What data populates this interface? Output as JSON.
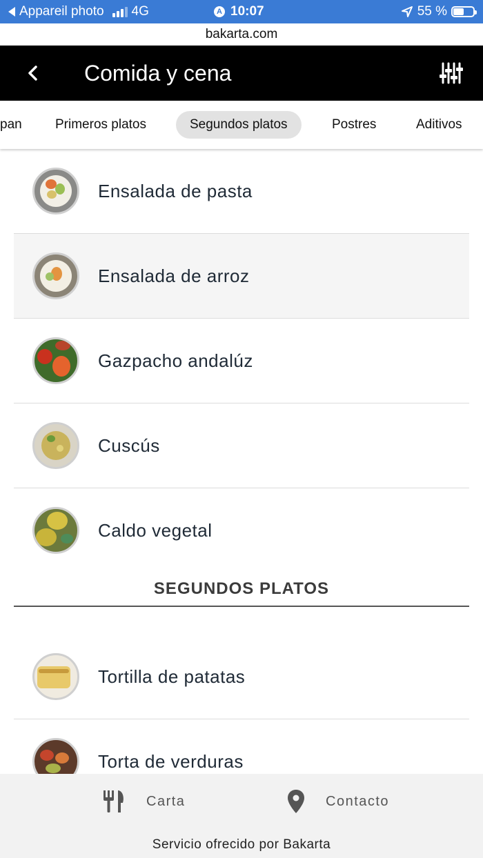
{
  "status_bar": {
    "back_app": "Appareil photo",
    "network": "4G",
    "time": "10:07",
    "battery": "55 %",
    "battery_level": 0.55
  },
  "url": "bakarta.com",
  "header": {
    "title": "Comida y cena",
    "back_icon": "chevron-left-icon",
    "filter_icon": "sliders-icon"
  },
  "tabs": [
    {
      "label": "pan"
    },
    {
      "label": "Primeros platos"
    },
    {
      "label": "Segundos platos",
      "active": true
    },
    {
      "label": "Postres"
    },
    {
      "label": "Aditivos"
    }
  ],
  "primeros": [
    {
      "name": "Ensalada de pasta"
    },
    {
      "name": "Ensalada de arroz"
    },
    {
      "name": "Gazpacho andalúz"
    },
    {
      "name": "Cuscús"
    },
    {
      "name": "Caldo vegetal"
    }
  ],
  "section_heading": "SEGUNDOS PLATOS",
  "segundos": [
    {
      "name": "Tortilla de patatas"
    },
    {
      "name": "Torta de verduras"
    }
  ],
  "bottom_nav": {
    "carta": "Carta",
    "carta_icon": "fork-knife-icon",
    "contacto": "Contacto",
    "contacto_icon": "map-pin-icon"
  },
  "footer": "Servicio ofrecido por Bakarta",
  "colors": {
    "status_bar": "#3a7bd5",
    "header_bg": "#000000",
    "active_tab": "#e2e2e2",
    "bottom_bar": "#f2f2f2"
  }
}
